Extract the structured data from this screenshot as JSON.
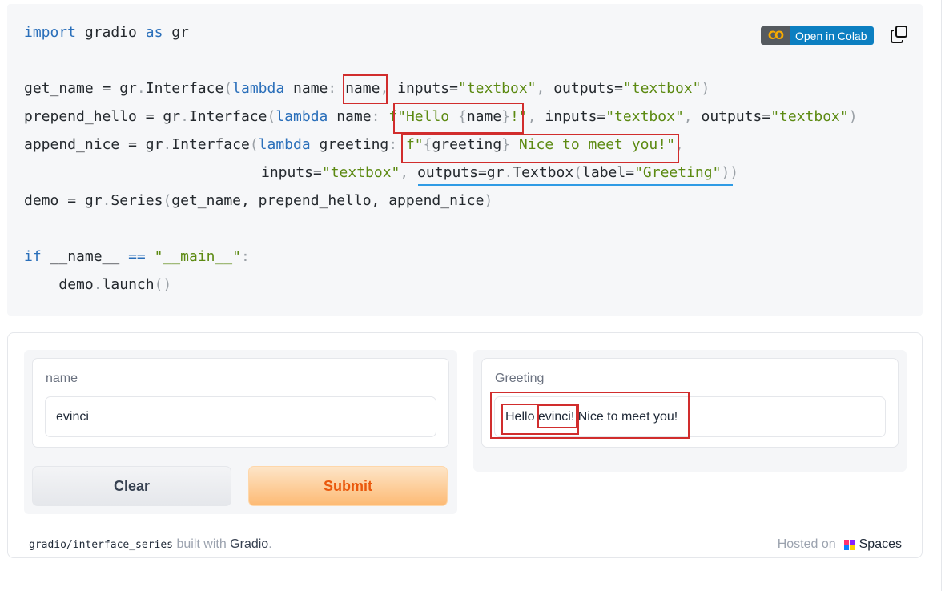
{
  "code": {
    "lines": {
      "import": {
        "kw_import": "import",
        "mod": "gradio",
        "kw_as": "as",
        "alias": "gr"
      },
      "get_name": {
        "var": "get_name",
        "eq": "=",
        "obj": "gr",
        "func": "Interface",
        "kw_lambda": "lambda",
        "param": "name",
        "body": "name",
        "inputs_kw": "inputs=",
        "inputs_val": "\"textbox\"",
        "outputs_kw": "outputs=",
        "outputs_val": "\"textbox\""
      },
      "prepend_hello": {
        "var": "prepend_hello",
        "eq": "=",
        "obj": "gr",
        "func": "Interface",
        "kw_lambda": "lambda",
        "param": "name",
        "body_a": "f\"Hello ",
        "body_b": "{",
        "body_c": "name",
        "body_d": "}",
        "body_e": "!\"",
        "inputs_kw": "inputs=",
        "inputs_val": "\"textbox\"",
        "outputs_kw": "outputs=",
        "outputs_val": "\"textbox\""
      },
      "append_nice": {
        "var": "append_nice",
        "eq": "=",
        "obj": "gr",
        "func": "Interface",
        "kw_lambda": "lambda",
        "param": "greeting",
        "body_a": "f\"",
        "body_b": "{",
        "body_c": "greeting",
        "body_d": "}",
        "body_e": " Nice to meet you!\""
      },
      "append_cont": {
        "inputs_kw": "inputs=",
        "inputs_val": "\"textbox\"",
        "outputs_kw": "outputs=",
        "obj": "gr",
        "func": "Textbox",
        "label_kw": "label=",
        "label_val": "\"Greeting\""
      },
      "demo": {
        "var": "demo",
        "eq": "=",
        "obj": "gr",
        "func": "Series",
        "args": "get_name, prepend_hello, append_nice"
      },
      "ifmain": {
        "kw_if": "if",
        "name": "__name__",
        "op": "==",
        "val": "\"__main__\""
      },
      "launch": {
        "obj": "demo",
        "func": "launch"
      }
    }
  },
  "colab": {
    "logo": "CO",
    "label": "Open in Colab"
  },
  "copy_icon": "copy-icon",
  "demo": {
    "input": {
      "label": "name",
      "value": "evinci"
    },
    "output": {
      "label": "Greeting",
      "prefix": "Hello ",
      "name": "evinci",
      "suffix": "! Nice to meet you!"
    },
    "buttons": {
      "clear": "Clear",
      "submit": "Submit"
    }
  },
  "footer": {
    "repo": "gradio/interface_series",
    "built_with": "built with",
    "gradio": "Gradio",
    "period": ".",
    "hosted_on": "Hosted on",
    "spaces": "Spaces"
  },
  "colors": {
    "keyword": "#2a6fba",
    "string": "#5c8a12",
    "highlight": "#d12d2d",
    "submit": "#ea580c"
  }
}
